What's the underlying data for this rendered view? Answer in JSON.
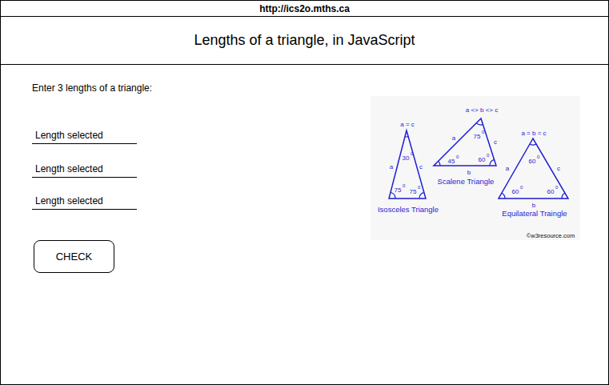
{
  "header": {
    "url": "http://ics2o.mths.ca",
    "title": "Lengths of a triangle, in JavaScript"
  },
  "form": {
    "prompt": "Enter 3 lengths of a triangle:",
    "fields": [
      {
        "placeholder": "Length selected"
      },
      {
        "placeholder": "Length selected"
      },
      {
        "placeholder": "Length selected"
      }
    ],
    "button": "CHECK"
  },
  "figure": {
    "triangles": [
      {
        "name": "Isosceles Triangle",
        "relation": "a = c",
        "sides": [
          "a",
          "c"
        ],
        "angles": [
          {
            "value": "30",
            "degree": "0"
          },
          {
            "value": "75",
            "degree": "0"
          },
          {
            "value": "75",
            "degree": "0"
          }
        ]
      },
      {
        "name": "Scalene Triangle",
        "relation": "a <> b <> c",
        "sides": [
          "a",
          "c",
          "b"
        ],
        "angles": [
          {
            "value": "75",
            "degree": "0"
          },
          {
            "value": "45",
            "degree": "0"
          },
          {
            "value": "60",
            "degree": "0"
          }
        ]
      },
      {
        "name": "Equilateral Traingle",
        "relation": "a = b = c",
        "sides": [
          "a",
          "c",
          "b"
        ],
        "angles": [
          {
            "value": "60",
            "degree": "0"
          },
          {
            "value": "60",
            "degree": "0"
          },
          {
            "value": "60",
            "degree": "0"
          }
        ]
      }
    ],
    "credit": "©w3resource.com"
  }
}
